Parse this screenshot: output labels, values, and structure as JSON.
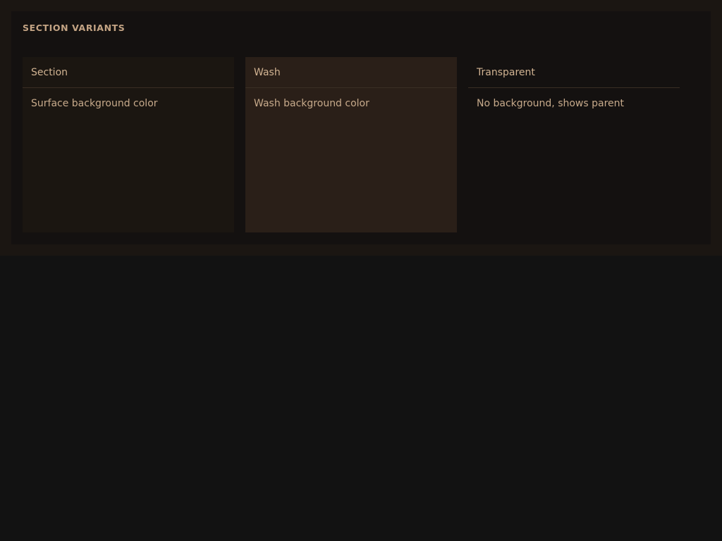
{
  "panel": {
    "title": "SECTION VARIANTS"
  },
  "cards": [
    {
      "title": "Section",
      "description": "Surface background color"
    },
    {
      "title": "Wash",
      "description": "Wash background color"
    },
    {
      "title": "Transparent",
      "description": "No background, shows parent"
    }
  ],
  "colors": {
    "page_background": "#121212",
    "outer_frame": "#1b1612",
    "panel_background": "#141110",
    "section_background": "#1b1611",
    "wash_background": "#2a1f18",
    "text_accent": "#c4a484",
    "divider": "#3a2e24"
  }
}
